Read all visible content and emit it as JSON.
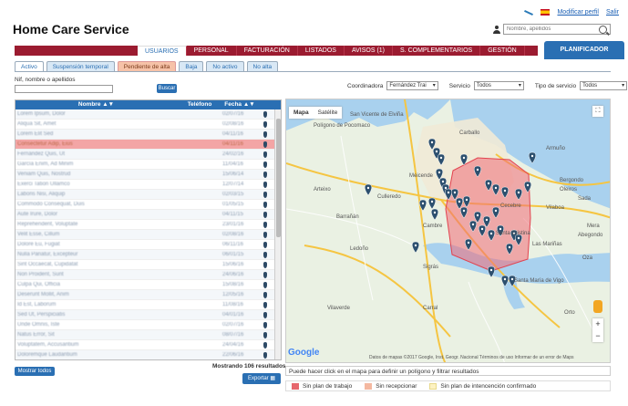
{
  "app": {
    "title": "Home Care Service"
  },
  "top": {
    "profile_link": "Modificar perfil",
    "exit_link": "Salir",
    "search_placeholder": "Nombre, apellidos"
  },
  "nav": {
    "items": [
      {
        "label": "USUARIOS",
        "active": true
      },
      {
        "label": "PERSONAL"
      },
      {
        "label": "FACTURACIÓN"
      },
      {
        "label": "LISTADOS"
      },
      {
        "label": "AVISOS (1)"
      },
      {
        "label": "S. COMPLEMENTARIOS"
      },
      {
        "label": "GESTIÓN"
      }
    ],
    "planner_label": "PLANIFICADOR"
  },
  "subtabs": [
    {
      "label": "Activo",
      "active": true
    },
    {
      "label": "Suspensión temporal"
    },
    {
      "label": "Pendiente de alta",
      "orange": true
    },
    {
      "label": "Baja"
    },
    {
      "label": "No activo"
    },
    {
      "label": "No alta"
    }
  ],
  "filters": {
    "nif_label": "Nif, nombre o apellidos",
    "search_button": "Buscar",
    "coordinator_label": "Coordinadora",
    "coordinator_value": "Fernández Trai",
    "service_label": "Servicio",
    "service_value": "Todos",
    "service_type_label": "Tipo de servicio",
    "service_type_value": "Todos"
  },
  "table": {
    "headers": {
      "name": "Nombre ▲▼",
      "phone": "Teléfono",
      "date": "Fecha ▲▼"
    },
    "rows": [
      {
        "name": "Lorem Ipsum, Dolor",
        "phone": "",
        "date": "02/07/16"
      },
      {
        "name": "Aliqua Sit, Amet",
        "phone": "",
        "date": "02/08/16"
      },
      {
        "name": "Lorem Elit Sed",
        "phone": "",
        "date": "04/11/16"
      },
      {
        "name": "Consectetur Adip, Eius",
        "phone": "",
        "date": "04/11/16",
        "selected": true
      },
      {
        "name": "Fernández Quis, Ut",
        "phone": "",
        "date": "24/02/16"
      },
      {
        "name": "García Enim, Ad Minim",
        "phone": "",
        "date": "11/04/16"
      },
      {
        "name": "Veniam Quis, Nostrud",
        "phone": "",
        "date": "15/06/14"
      },
      {
        "name": "Exerci Tation Ullamco",
        "phone": "",
        "date": "12/07/14"
      },
      {
        "name": "Laboris Nisi, Aliquip",
        "phone": "",
        "date": "02/03/15"
      },
      {
        "name": "Commodo Consequat, Duis",
        "phone": "",
        "date": "01/05/15"
      },
      {
        "name": "Aute Irure, Dolor",
        "phone": "",
        "date": "04/11/15"
      },
      {
        "name": "Reprehenderit, Voluptate",
        "phone": "",
        "date": "23/01/16"
      },
      {
        "name": "Velit Esse, Cillum",
        "phone": "",
        "date": "02/08/16"
      },
      {
        "name": "Dolore Eu, Fugiat",
        "phone": "",
        "date": "06/11/16"
      },
      {
        "name": "Nulla Pariatur, Excepteur",
        "phone": "",
        "date": "06/01/15"
      },
      {
        "name": "Sint Occaecat, Cupidatat",
        "phone": "",
        "date": "15/06/16"
      },
      {
        "name": "Non Proident, Sunt",
        "phone": "",
        "date": "24/06/16"
      },
      {
        "name": "Culpa Qui, Officia",
        "phone": "",
        "date": "15/08/16"
      },
      {
        "name": "Deserunt Mollit, Anim",
        "phone": "",
        "date": "12/05/16"
      },
      {
        "name": "Id Est, Laborum",
        "phone": "",
        "date": "11/08/16"
      },
      {
        "name": "Sed Ut, Perspiciatis",
        "phone": "",
        "date": "04/01/16"
      },
      {
        "name": "Unde Omnis, Iste",
        "phone": "",
        "date": "02/07/16"
      },
      {
        "name": "Natus Error, Sit",
        "phone": "",
        "date": "08/07/16"
      },
      {
        "name": "Voluptatem, Accusantium",
        "phone": "",
        "date": "24/04/16"
      },
      {
        "name": "Doloremque Laudantium",
        "phone": "",
        "date": "22/06/16"
      }
    ]
  },
  "footer": {
    "show_all": "Mostrar todos",
    "count": "Mostrando 106 resultados",
    "export": "Exportar"
  },
  "map": {
    "type_map": "Mapa",
    "type_satellite": "Satélite",
    "attribution": "Datos de mapas ©2017 Google, Inst. Geogr. Nacional   Términos de uso   Informar de un error de Maps",
    "google": "Google",
    "hint": "Puede hacer click en el mapa para definir un polígono y filtrar resultados",
    "places": [
      "San Vicente de Elviña",
      "Polígono de Pocomaco",
      "Carballo",
      "Armuño",
      "Arteixo",
      "Culleredo",
      "Meicende",
      "Santa Cristina",
      "Bergondo",
      "Barrañán",
      "Ledoño",
      "Sigrás",
      "Vilaboa",
      "Santa María de Vigo",
      "Cambre",
      "Las Mariñas",
      "Vilaverde",
      "Cecebre",
      "Carral",
      "Orto",
      "Abegondo",
      "Sada",
      "Oleiros",
      "Mera",
      "Oza"
    ]
  },
  "legend": [
    {
      "label": "Sin plan de trabajo",
      "color": "#e6676d"
    },
    {
      "label": "Sin recepcionar",
      "color": "#f4b8a0"
    },
    {
      "label": "Sin plan de intencención confirmado",
      "color": "#fdf2c2"
    }
  ],
  "colors": {
    "brand_red": "#9b1b30",
    "brand_blue": "#2a6fb3",
    "polygon": "#f06c78"
  }
}
